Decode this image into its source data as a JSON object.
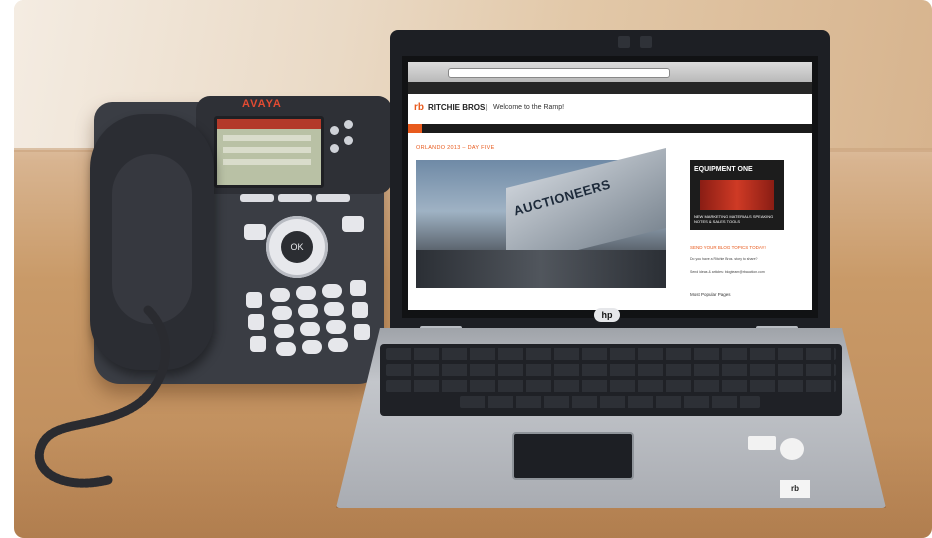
{
  "scene": {
    "phone": {
      "brand": "AVAYA",
      "nav_center_key": "OK"
    },
    "laptop": {
      "brand_logo": "hp",
      "sticker_text": "rb"
    },
    "website": {
      "logo_mark": "rb",
      "logo_name": "RITCHIE BROS.",
      "tagline": "Welcome to the Ramp!",
      "post_title": "ORLANDO 2013 – DAY FIVE",
      "photo_text": "AUCTIONEERS",
      "ad_title": "EQUIPMENT ONE",
      "ad_subtitle": "NEW MARKETING MATERIALS SPEAKING NOTES & SALES TOOLS",
      "sidebar_heading": "SEND YOUR BLOG TOPICS TODAY!",
      "sidebar_text_1": "Do you have a Ritchie Bros. story to share?",
      "sidebar_text_2": "Send ideas & articles: blogteam@rbauction.com",
      "sidebar_heading_2": "Most Popular Pages"
    }
  }
}
